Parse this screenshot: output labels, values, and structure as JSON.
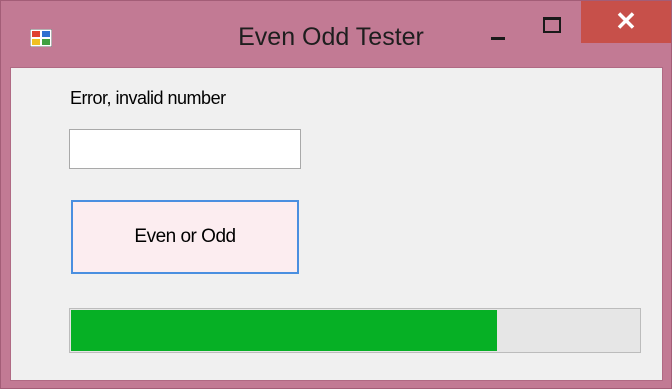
{
  "window": {
    "title": "Even Odd Tester",
    "close_glyph": "✕"
  },
  "icons": {
    "app": "app-form-icon",
    "minimize": "minimize-icon",
    "maximize": "maximize-icon",
    "close": "close-icon"
  },
  "form": {
    "status_label": "Error, invalid number",
    "number_input_value": "",
    "button_label": "Even or Odd",
    "progress_fraction": 0.75
  },
  "colors": {
    "frame": "#c27a94",
    "close_button": "#c7504a",
    "progress_fill": "#06b025",
    "button_face": "#fcedf0",
    "button_focus_border": "#4a8fe0"
  }
}
